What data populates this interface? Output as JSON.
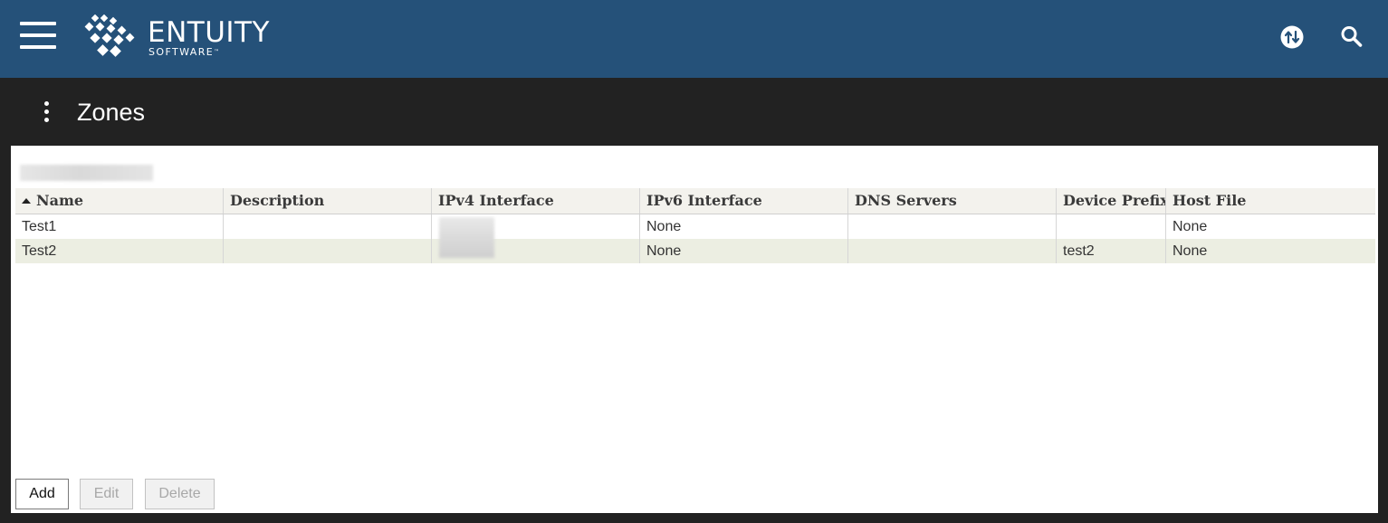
{
  "header": {
    "brand_name": "ENTUITY",
    "brand_sub": "SOFTWARE",
    "brand_tm": "™",
    "bg_color": "#255179",
    "icons": [
      "menu-icon",
      "sync-arrows-icon",
      "search-icon"
    ]
  },
  "page": {
    "title": "Zones"
  },
  "table": {
    "columns": [
      "Name",
      "Description",
      "IPv4 Interface",
      "IPv6 Interface",
      "DNS Servers",
      "Device Prefix",
      "Host File"
    ],
    "sort_column": "Name",
    "sort_direction": "ascending",
    "rows": [
      {
        "name": "Test1",
        "description": "",
        "ipv4_interface": "",
        "ipv6_interface": "None",
        "dns_servers": "",
        "device_prefix": "",
        "host_file": "None"
      },
      {
        "name": "Test2",
        "description": "",
        "ipv4_interface": "",
        "ipv6_interface": "None",
        "dns_servers": "",
        "device_prefix": "test2",
        "host_file": "None"
      }
    ]
  },
  "actions": {
    "add": "Add",
    "edit": "Edit",
    "delete": "Delete"
  }
}
